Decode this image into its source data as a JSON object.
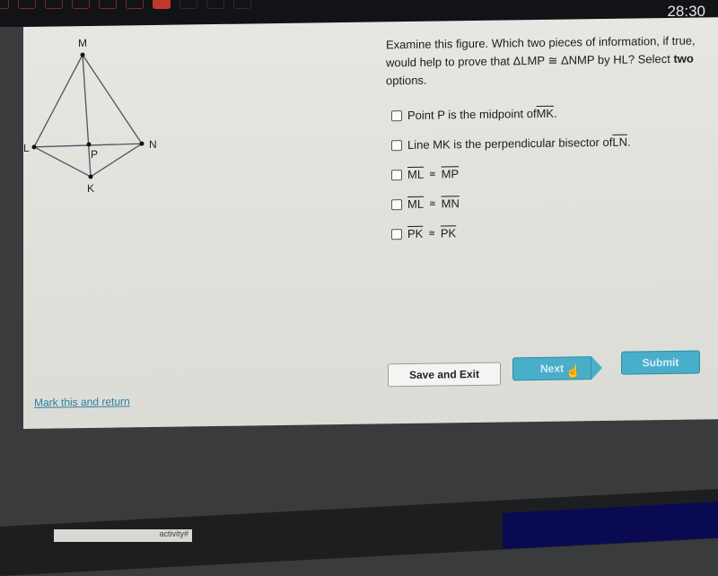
{
  "topbar": {
    "progress": {
      "completed": 6,
      "current": 7,
      "remaining_visible": 3
    },
    "timer": "28:30"
  },
  "figure": {
    "points": {
      "M": "M",
      "L": "L",
      "N": "N",
      "P": "P",
      "K": "K"
    }
  },
  "question": {
    "line_1": "Examine this figure.  Which two pieces of information, if true, would help to prove that ΔLMP ≅ ΔNMP by HL? Select ",
    "emphasis": "two",
    "line_end": " options."
  },
  "options": [
    {
      "prefix": "Point P is the midpoint of ",
      "segment": "MK",
      "suffix": ".",
      "checked": false
    },
    {
      "prefix": "Line MK is the perpendicular bisector of ",
      "segment": "LN",
      "suffix": ".",
      "checked": false
    },
    {
      "left": "ML",
      "symbol": "≅",
      "right": "MP",
      "checked": false
    },
    {
      "left": "ML",
      "symbol": "≅",
      "right": "MN",
      "checked": false
    },
    {
      "left": "PK",
      "symbol": "≅",
      "right": "PK",
      "checked": false
    }
  ],
  "buttons": {
    "save_exit": "Save and Exit",
    "next": "Next",
    "submit": "Submit"
  },
  "mark_link": "Mark this and return",
  "taskbar_tooltip": "activity#",
  "colors": {
    "accent": "#49aec9",
    "progress_current": "#c0392b",
    "link": "#2b7fa3"
  }
}
